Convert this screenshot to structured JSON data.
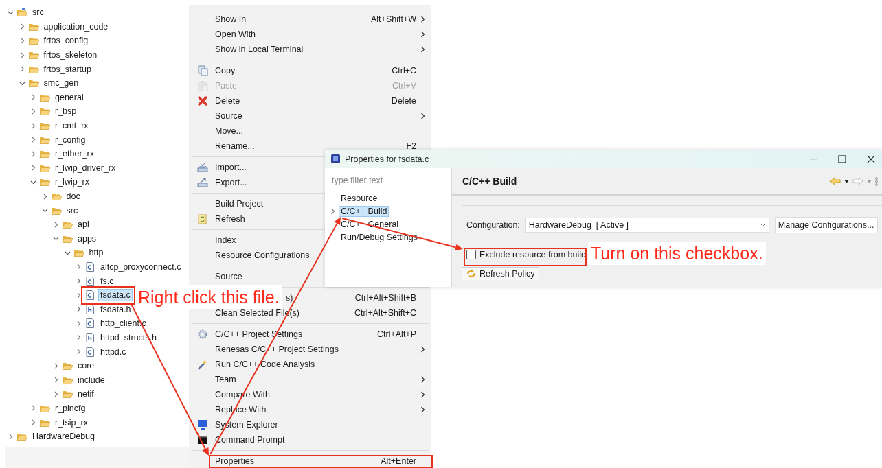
{
  "project_tree": {
    "items": [
      {
        "label": "src",
        "kind": "project-folder",
        "expanded": true,
        "selected": false,
        "children": [
          {
            "label": "application_code",
            "kind": "folder",
            "expanded": false,
            "selected": false
          },
          {
            "label": "frtos_config",
            "kind": "folder",
            "expanded": false,
            "selected": false
          },
          {
            "label": "frtos_skeleton",
            "kind": "folder",
            "expanded": false,
            "selected": false
          },
          {
            "label": "frtos_startup",
            "kind": "folder",
            "expanded": false,
            "selected": false
          },
          {
            "label": "smc_gen",
            "kind": "folder",
            "expanded": true,
            "selected": false,
            "children": [
              {
                "label": "general",
                "kind": "folder",
                "expanded": false,
                "selected": false
              },
              {
                "label": "r_bsp",
                "kind": "folder",
                "expanded": false,
                "selected": false
              },
              {
                "label": "r_cmt_rx",
                "kind": "folder",
                "expanded": false,
                "selected": false
              },
              {
                "label": "r_config",
                "kind": "folder",
                "expanded": false,
                "selected": false
              },
              {
                "label": "r_ether_rx",
                "kind": "folder",
                "expanded": false,
                "selected": false
              },
              {
                "label": "r_lwip_driver_rx",
                "kind": "folder",
                "expanded": false,
                "selected": false
              },
              {
                "label": "r_lwip_rx",
                "kind": "folder",
                "expanded": true,
                "selected": false,
                "children": [
                  {
                    "label": "doc",
                    "kind": "folder",
                    "expanded": false,
                    "selected": false
                  },
                  {
                    "label": "src",
                    "kind": "folder",
                    "expanded": true,
                    "selected": false,
                    "children": [
                      {
                        "label": "api",
                        "kind": "folder",
                        "expanded": false,
                        "selected": false
                      },
                      {
                        "label": "apps",
                        "kind": "folder",
                        "expanded": true,
                        "selected": false,
                        "children": [
                          {
                            "label": "http",
                            "kind": "folder",
                            "expanded": true,
                            "selected": false,
                            "children": [
                              {
                                "label": "altcp_proxyconnect.c",
                                "kind": "c-file",
                                "expanded": false,
                                "selected": false
                              },
                              {
                                "label": "fs.c",
                                "kind": "c-file",
                                "expanded": false,
                                "selected": false
                              },
                              {
                                "label": "fsdata.c",
                                "kind": "c-file",
                                "expanded": false,
                                "selected": true
                              },
                              {
                                "label": "fsdata.h",
                                "kind": "h-file",
                                "expanded": false,
                                "selected": false
                              },
                              {
                                "label": "http_client.c",
                                "kind": "c-file",
                                "expanded": false,
                                "selected": false
                              },
                              {
                                "label": "httpd_structs.h",
                                "kind": "h-file",
                                "expanded": false,
                                "selected": false
                              },
                              {
                                "label": "httpd.c",
                                "kind": "c-file",
                                "expanded": false,
                                "selected": false
                              }
                            ]
                          }
                        ]
                      },
                      {
                        "label": "core",
                        "kind": "folder",
                        "expanded": false,
                        "selected": false
                      },
                      {
                        "label": "include",
                        "kind": "folder",
                        "expanded": false,
                        "selected": false
                      },
                      {
                        "label": "netif",
                        "kind": "folder",
                        "expanded": false,
                        "selected": false
                      }
                    ]
                  }
                ]
              },
              {
                "label": "r_pincfg",
                "kind": "folder",
                "expanded": false,
                "selected": false
              },
              {
                "label": "r_tsip_rx",
                "kind": "folder",
                "expanded": false,
                "selected": false
              }
            ]
          }
        ]
      },
      {
        "label": "HardwareDebug",
        "kind": "folder",
        "expanded": false,
        "selected": false
      }
    ]
  },
  "context_menu": {
    "items": [
      {
        "kind": "item",
        "label": "Show In",
        "shortcut": "Alt+Shift+W",
        "submenu": true,
        "disabled": false
      },
      {
        "kind": "item",
        "label": "Open With",
        "submenu": true,
        "disabled": false
      },
      {
        "kind": "item",
        "label": "Show in Local Terminal",
        "submenu": true,
        "disabled": false
      },
      {
        "kind": "separator"
      },
      {
        "kind": "item",
        "label": "Copy",
        "shortcut": "Ctrl+C",
        "submenu": false,
        "disabled": false
      },
      {
        "kind": "item",
        "label": "Paste",
        "shortcut": "Ctrl+V",
        "submenu": false,
        "disabled": true
      },
      {
        "kind": "item",
        "label": "Delete",
        "shortcut": "Delete",
        "submenu": false,
        "disabled": false
      },
      {
        "kind": "item",
        "label": "Source",
        "submenu": true,
        "disabled": false
      },
      {
        "kind": "item",
        "label": "Move...",
        "submenu": false,
        "disabled": false
      },
      {
        "kind": "item",
        "label": "Rename...",
        "shortcut": "F2",
        "submenu": false,
        "disabled": false
      },
      {
        "kind": "separator"
      },
      {
        "kind": "item",
        "label": "Import...",
        "submenu": false,
        "disabled": false
      },
      {
        "kind": "item",
        "label": "Export...",
        "submenu": false,
        "disabled": false
      },
      {
        "kind": "separator"
      },
      {
        "kind": "item",
        "label": "Build Project",
        "submenu": false,
        "disabled": false
      },
      {
        "kind": "item",
        "label": "Refresh",
        "submenu": false,
        "disabled": false
      },
      {
        "kind": "separator"
      },
      {
        "kind": "item",
        "label": "Index",
        "submenu": false,
        "disabled": false
      },
      {
        "kind": "item",
        "label": "Resource Configurations",
        "submenu": false,
        "disabled": false
      },
      {
        "kind": "separator"
      },
      {
        "kind": "item",
        "label": "Source",
        "submenu": false,
        "disabled": false
      },
      {
        "kind": "separator"
      },
      {
        "kind": "covered",
        "label": "s)",
        "shortcut": "Ctrl+Alt+Shift+B",
        "submenu": false,
        "disabled": false
      },
      {
        "kind": "item",
        "label": "Clean Selected File(s)",
        "shortcut": "Ctrl+Alt+Shift+C",
        "submenu": false,
        "disabled": false
      },
      {
        "kind": "separator"
      },
      {
        "kind": "item",
        "label": "C/C++ Project Settings",
        "shortcut": "Ctrl+Alt+P",
        "submenu": false,
        "disabled": false
      },
      {
        "kind": "item",
        "label": "Renesas C/C++ Project Settings",
        "submenu": true,
        "disabled": false
      },
      {
        "kind": "item",
        "label": "Run C/C++ Code Analysis",
        "submenu": false,
        "disabled": false
      },
      {
        "kind": "item",
        "label": "Team",
        "submenu": true,
        "disabled": false
      },
      {
        "kind": "item",
        "label": "Compare With",
        "submenu": true,
        "disabled": false
      },
      {
        "kind": "item",
        "label": "Replace With",
        "submenu": true,
        "disabled": false
      },
      {
        "kind": "item",
        "label": "System Explorer",
        "submenu": false,
        "disabled": false
      },
      {
        "kind": "item",
        "label": "Command Prompt",
        "submenu": false,
        "disabled": false
      },
      {
        "kind": "separator"
      },
      {
        "kind": "item",
        "label": "Properties",
        "shortcut": "Alt+Enter",
        "submenu": false,
        "disabled": false
      }
    ]
  },
  "properties_dialog": {
    "title": "Properties for fsdata.c",
    "filter": {
      "placeholder": "type filter text"
    },
    "pages": [
      {
        "label": "Resource",
        "kind": "leaf",
        "selected": false
      },
      {
        "label": "C/C++ Build",
        "kind": "branch",
        "selected": true
      },
      {
        "label": "C/C++ General",
        "kind": "leaf",
        "selected": false
      },
      {
        "label": "Run/Debug Settings",
        "kind": "leaf",
        "selected": false
      }
    ],
    "page_title": "C/C++ Build",
    "configuration": {
      "label": "Configuration:",
      "value": "HardwareDebug  [ Active ]",
      "button": "Manage Configurations..."
    },
    "exclude_checkbox": {
      "label": "Exclude resource from build",
      "checked": false
    },
    "tabs": [
      {
        "label": "Refresh Policy",
        "selected": true
      }
    ]
  },
  "annotations": [
    {
      "text": "Right click this file."
    },
    {
      "text": "Turn on this checkbox."
    }
  ]
}
